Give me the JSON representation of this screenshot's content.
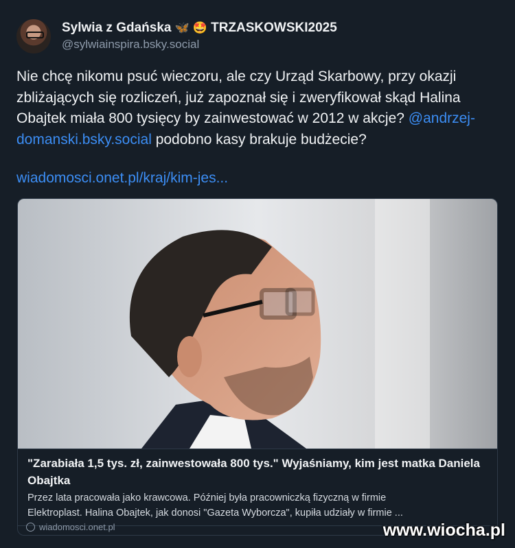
{
  "author": {
    "display_name": "Sylwia z Gdańska",
    "name_emojis": "🦋 🤩",
    "badge": "TRZASKOWSKI2025",
    "handle": "@sylwiainspira.bsky.social"
  },
  "post": {
    "text_before_mention": "Nie chcę nikomu psuć wieczoru, ale czy Urząd Skarbowy, przy okazji zbliżających się rozliczeń, już zapoznał się i zweryfikował skąd Halina Obajtek miała 800 tysięcy by zainwestować w 2012 w akcje? ",
    "mention": "@andrzej-domanski.bsky.social",
    "text_after_mention": " podobno kasy brakuje budżecie?",
    "link": "wiadomosci.onet.pl/kraj/kim-jes..."
  },
  "card": {
    "title": "\"Zarabiała 1,5 tys. zł, zainwestowała 800 tys.\" Wyjaśniamy, kim jest matka Daniela Obajtka",
    "description_line1": "Przez lata pracowała jako krawcowa. Później była pracowniczką fizyczną w firmie",
    "description_line2": "Elektroplast. Halina Obajtek, jak donosi \"Gazeta Wyborcza\", kupiła udziały w firmie ...",
    "domain": "wiadomosci.onet.pl"
  },
  "watermark": "www.wiocha.pl",
  "colors": {
    "background": "#161e27",
    "link": "#3c8ef5",
    "border": "#2e3a48"
  }
}
